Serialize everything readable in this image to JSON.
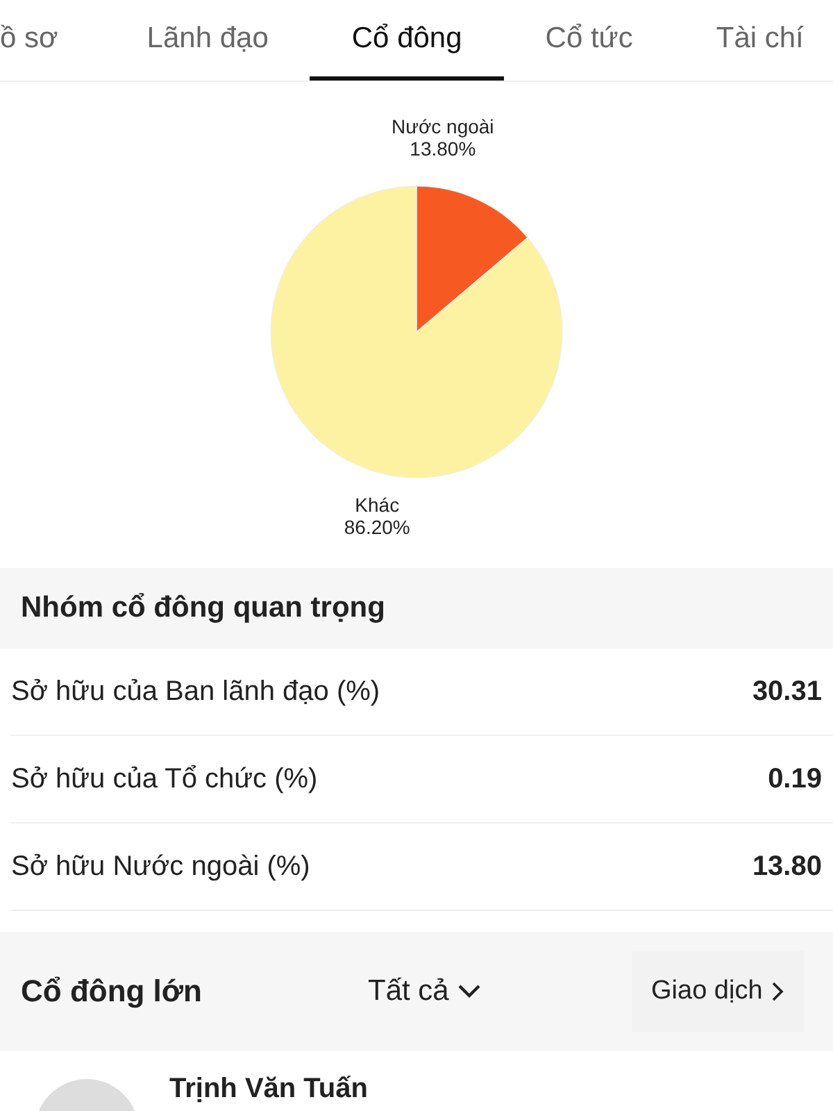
{
  "tabs": [
    {
      "label": "ồ sơ",
      "selected": false
    },
    {
      "label": "Lãnh đạo",
      "selected": false
    },
    {
      "label": "Cổ đông",
      "selected": true
    },
    {
      "label": "Cổ tức",
      "selected": false
    },
    {
      "label": "Tài chí",
      "selected": false
    }
  ],
  "ownership_chart": {
    "chart_data": {
      "type": "pie",
      "categories": [
        "Nước ngoài",
        "Khác"
      ],
      "values": [
        13.8,
        86.2
      ],
      "colors": [
        "#f65a22",
        "#fdf2a2"
      ],
      "value_labels": [
        "13.80%",
        "86.20%"
      ]
    }
  },
  "key_groups": {
    "title": "Nhóm cổ đông quan trọng",
    "rows": [
      {
        "label": "Sở hữu của Ban lãnh đạo (%)",
        "value": "30.31"
      },
      {
        "label": "Sở hữu của Tổ chức (%)",
        "value": "0.19"
      },
      {
        "label": "Sở hữu Nước ngoài (%)",
        "value": "13.80"
      }
    ]
  },
  "major_holders": {
    "title": "Cổ đông lớn",
    "filter": "Tất cả",
    "link": "Giao dịch",
    "items": [
      {
        "name": "Trịnh Văn Tuấn"
      }
    ]
  }
}
